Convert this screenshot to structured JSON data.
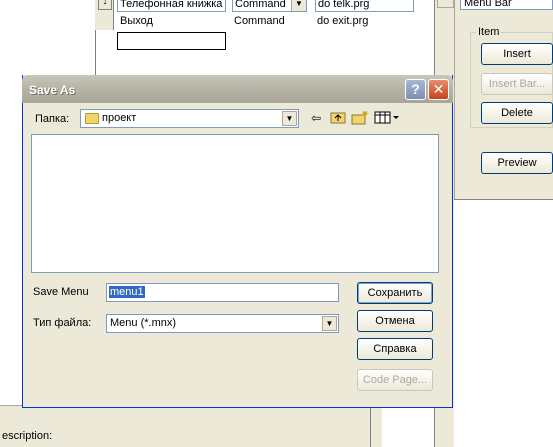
{
  "background": {
    "grid": {
      "row1": {
        "prompt": "Телефонная книжка",
        "result": "Command",
        "option": "do telk.prg"
      },
      "row2": {
        "prompt": "Выход",
        "result": "Command",
        "option": "do exit.prg"
      }
    },
    "menu_level": "Menu Bar",
    "item_group": {
      "label": "Item",
      "insert": "Insert",
      "insert_bar": "Insert Bar...",
      "delete": "Delete"
    },
    "preview": "Preview",
    "description_label": "escription:"
  },
  "dialog": {
    "title": "Save As",
    "folder_label": "Папка:",
    "folder_value": "проект",
    "name_label": "Save Menu",
    "name_value": "menu1",
    "type_label": "Тип файла:",
    "type_value": "Menu (*.mnx)",
    "buttons": {
      "save": "Сохранить",
      "cancel": "Отмена",
      "help": "Справка",
      "code_page": "Code Page..."
    },
    "titlebar": {
      "help_glyph": "?",
      "close_glyph": "✕"
    }
  }
}
